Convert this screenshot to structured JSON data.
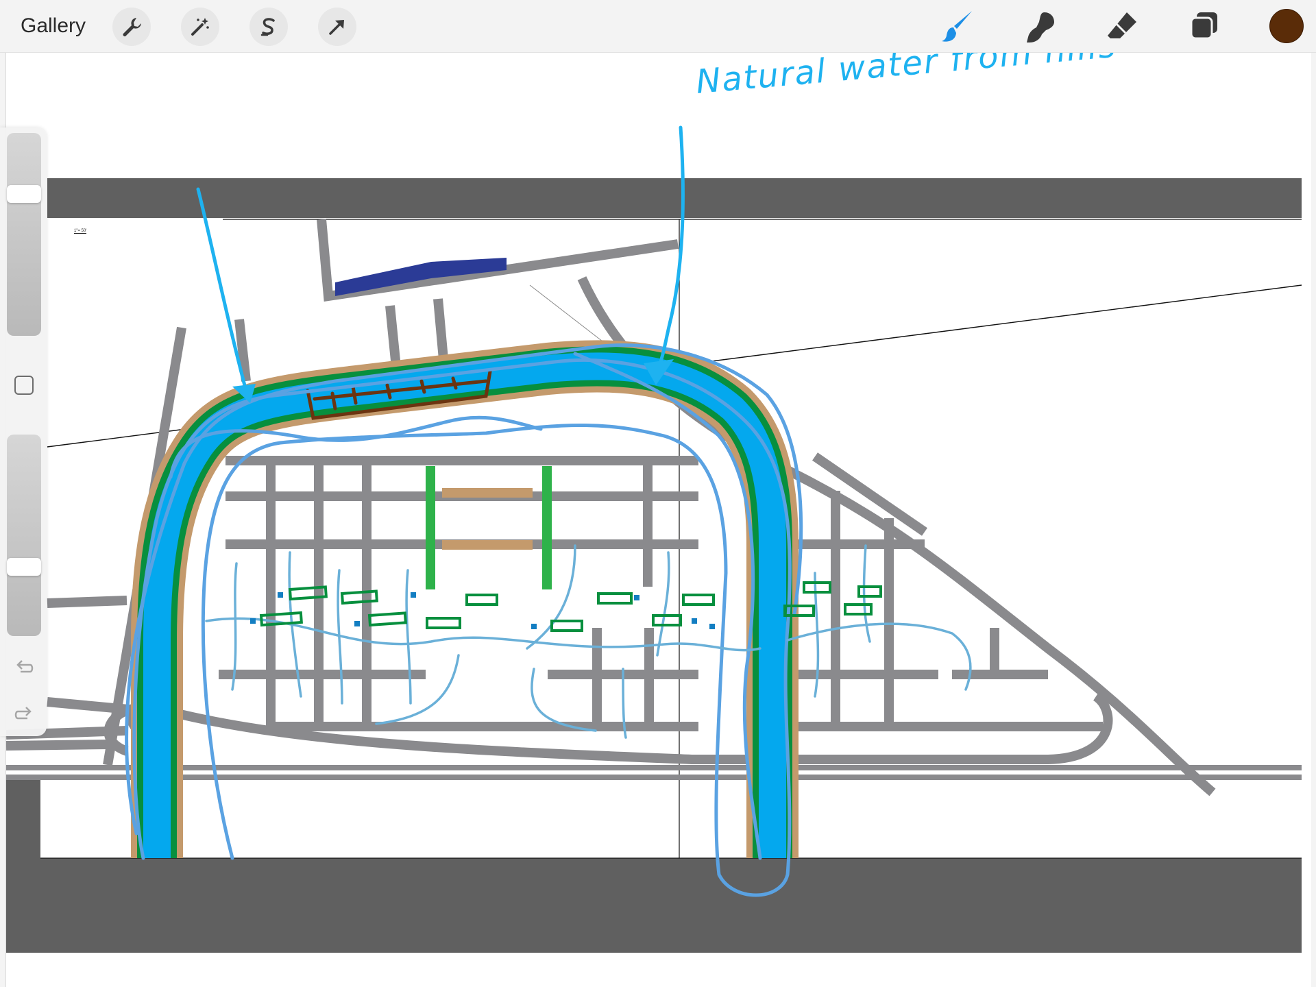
{
  "app": {
    "gallery_label": "Gallery"
  },
  "toolbar": {
    "actions_icon": "wrench-icon",
    "adjustments_icon": "magic-wand-icon",
    "selection_icon": "selection-s-icon",
    "transform_icon": "arrow-cursor-icon",
    "brush_icon": "brush-icon",
    "smudge_icon": "smudge-icon",
    "eraser_icon": "eraser-icon",
    "layers_icon": "layers-icon",
    "active_color": "#5a2c08"
  },
  "sidebar": {
    "brush_size_level": 0.72,
    "opacity_level": 0.33,
    "undo_icon": "undo-icon",
    "redo_icon": "redo-icon",
    "modify_icon": "square-modify-icon"
  },
  "canvas": {
    "annotation": "Natural water from hills",
    "tiny_label": "1\"= 50'",
    "colors": {
      "road": "#8a8a8d",
      "band": "#606060",
      "river": "#04a8ee",
      "river_edge": "#078f3e",
      "bank": "#c49a6c",
      "sketch": "#5aa2e2",
      "annotation": "#1eb2f0",
      "dock": "#6b3410",
      "park": "#2eb24a",
      "navy": "#2b3b96"
    }
  }
}
